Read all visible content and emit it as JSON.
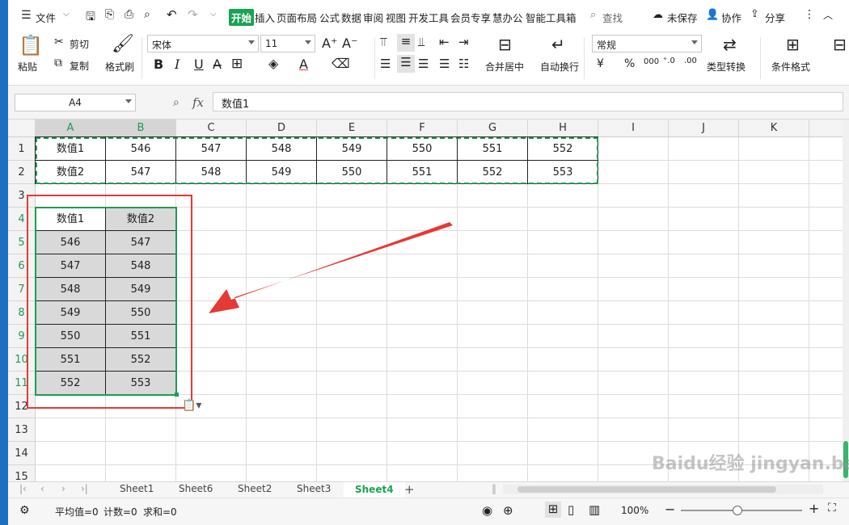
{
  "menubar": {
    "file": "文件",
    "tabs": [
      "开始",
      "插入",
      "页面布局",
      "公式",
      "数据",
      "审阅",
      "视图",
      "开发工具",
      "会员专享",
      "慧办公",
      "智能工具箱"
    ],
    "search": "查找",
    "unsaved": "未保存",
    "collab": "协作",
    "share": "分享"
  },
  "ribbon": {
    "paste": "粘贴",
    "cut": "剪切",
    "copy": "复制",
    "format_painter": "格式刷",
    "font_name": "宋体",
    "font_size": "11",
    "merge_center": "合并居中",
    "wrap_text": "自动换行",
    "number_format": "常规",
    "type_convert": "类型转换",
    "cond_format": "条件格式"
  },
  "formula_bar": {
    "cell_ref": "A4",
    "fx": "fx",
    "content": "数值1"
  },
  "columns": [
    "A",
    "B",
    "C",
    "D",
    "E",
    "F",
    "G",
    "H",
    "I",
    "J",
    "K"
  ],
  "rows": [
    "1",
    "2",
    "3",
    "4",
    "5",
    "6",
    "7",
    "8",
    "9",
    "10",
    "11",
    "12",
    "13",
    "14",
    "15"
  ],
  "table_top": {
    "row1": [
      "数值1",
      "546",
      "547",
      "548",
      "549",
      "550",
      "551",
      "552"
    ],
    "row2": [
      "数值2",
      "547",
      "548",
      "549",
      "550",
      "551",
      "552",
      "553"
    ]
  },
  "table_transposed": {
    "header": [
      "数值1",
      "数值2"
    ],
    "rows": [
      [
        "546",
        "547"
      ],
      [
        "547",
        "548"
      ],
      [
        "548",
        "549"
      ],
      [
        "549",
        "550"
      ],
      [
        "550",
        "551"
      ],
      [
        "551",
        "552"
      ],
      [
        "552",
        "553"
      ]
    ]
  },
  "sheets": [
    "Sheet1",
    "Sheet6",
    "Sheet2",
    "Sheet3",
    "Sheet4"
  ],
  "active_sheet": "Sheet4",
  "status": {
    "avg": "平均值=0",
    "count": "计数=0",
    "sum": "求和=0",
    "zoom": "100%"
  },
  "watermark": "Baidu经验 jingyan.baidu.com",
  "colors": {
    "accent": "#1aa352",
    "selection": "#1f9a55",
    "highlight": "#e53935"
  }
}
